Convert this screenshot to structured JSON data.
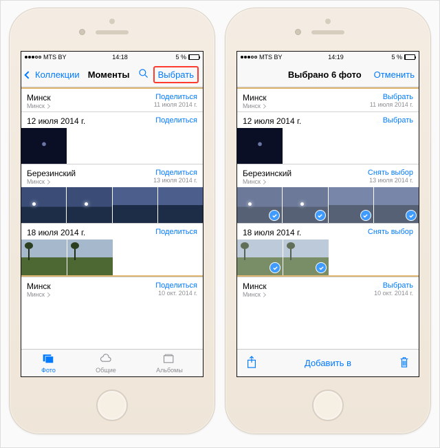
{
  "statusbar": {
    "carrier": "MTS BY",
    "time_left": "14:18",
    "time_right": "14:19",
    "battery_pct": "5 %",
    "bt_icon": "bluetooth-icon",
    "battery_icon": "battery-icon"
  },
  "left": {
    "nav": {
      "back": "Коллекции",
      "title": "Моменты",
      "select": "Выбрать"
    },
    "sections": [
      {
        "title": "Минск",
        "subtitle": "Минск",
        "action": "Поделиться",
        "date": "11 июля 2014 г.",
        "thumbs": []
      },
      {
        "title": "12 июля 2014 г.",
        "subtitle": "",
        "action": "Поделиться",
        "date": "",
        "thumbs": [
          "dark"
        ]
      },
      {
        "title": "Березинский",
        "subtitle": "Минск",
        "action": "Поделиться",
        "date": "13 июля 2014 г.",
        "thumbs": [
          "sky",
          "sky",
          "sky-lit",
          "sky-lit"
        ]
      },
      {
        "title": "18 июля 2014 г.",
        "subtitle": "",
        "action": "Поделиться",
        "date": "",
        "thumbs": [
          "grass",
          "grass"
        ]
      },
      {
        "title": "Минск",
        "subtitle": "Минск",
        "action": "Поделиться",
        "date": "10 окт. 2014 г.",
        "thumbs": []
      }
    ],
    "tabs": {
      "photos": "Фото",
      "shared": "Общие",
      "albums": "Альбомы"
    }
  },
  "right": {
    "nav": {
      "title": "Выбрано 6 фото",
      "cancel": "Отменить"
    },
    "sections": [
      {
        "title": "Минск",
        "subtitle": "Минск",
        "action": "Выбрать",
        "date": "11 июля 2014 г.",
        "thumbs": []
      },
      {
        "title": "12 июля 2014 г.",
        "subtitle": "",
        "action": "Выбрать",
        "date": "",
        "thumbs": [
          "dark"
        ]
      },
      {
        "title": "Березинский",
        "subtitle": "Минск",
        "action": "Снять выбор",
        "date": "13 июля 2014 г.",
        "thumbs": [
          "sky",
          "sky",
          "sky-lit",
          "sky-lit"
        ],
        "selected": true
      },
      {
        "title": "18 июля 2014 г.",
        "subtitle": "",
        "action": "Снять выбор",
        "date": "",
        "thumbs": [
          "grass",
          "grass"
        ],
        "selected": true
      },
      {
        "title": "Минск",
        "subtitle": "Минск",
        "action": "Выбрать",
        "date": "10 окт. 2014 г.",
        "thumbs": []
      }
    ],
    "toolbar": {
      "add_to": "Добавить в"
    }
  }
}
